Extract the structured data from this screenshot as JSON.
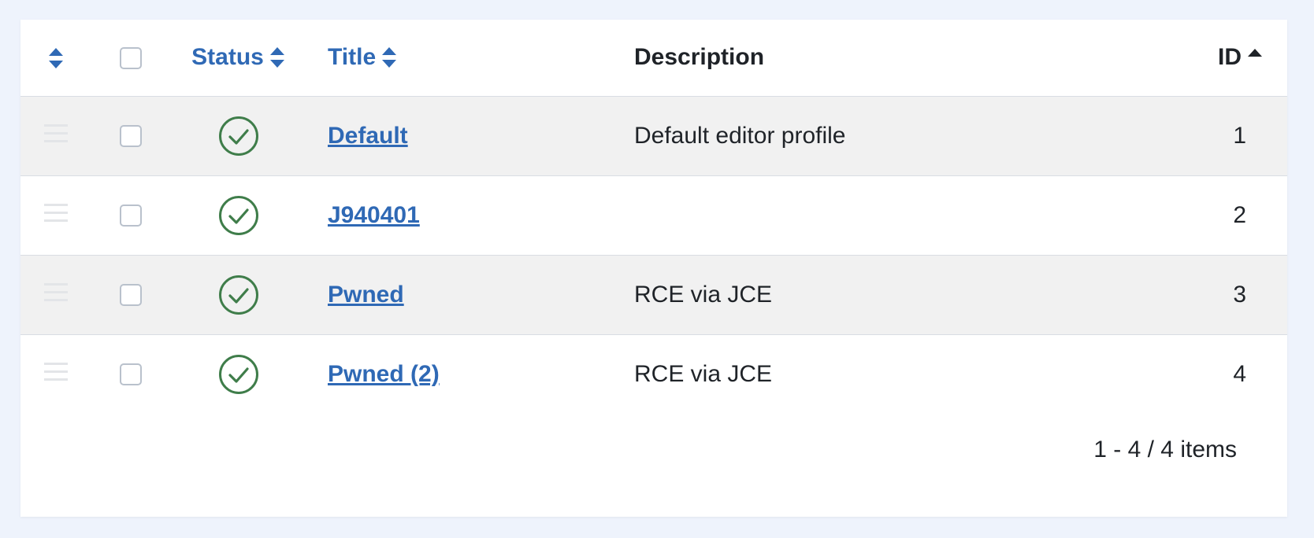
{
  "header": {
    "status_label": "Status",
    "title_label": "Title",
    "description_label": "Description",
    "id_label": "ID"
  },
  "colors": {
    "link": "#2f69b5",
    "status_published": "#3f7d4a",
    "row_alt": "#f1f1f1",
    "background": "#eef3fc"
  },
  "rows": [
    {
      "title": "Default",
      "description": "Default editor profile",
      "id": "1",
      "status": "published"
    },
    {
      "title": "J940401",
      "description": "",
      "id": "2",
      "status": "published"
    },
    {
      "title": "Pwned",
      "description": "RCE via JCE",
      "id": "3",
      "status": "published"
    },
    {
      "title": "Pwned (2)",
      "description": "RCE via JCE",
      "id": "4",
      "status": "published"
    }
  ],
  "pagination": {
    "summary": "1 - 4 / 4 items"
  }
}
